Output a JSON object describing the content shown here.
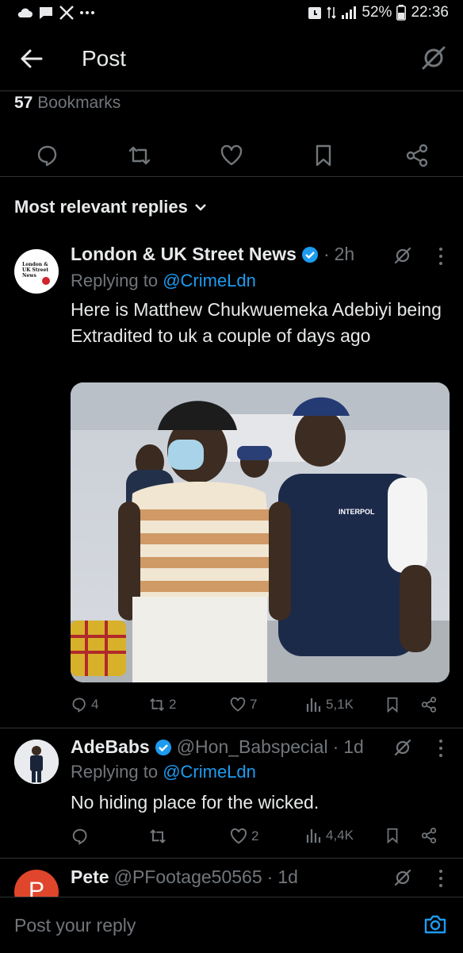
{
  "status_bar": {
    "battery": "52%",
    "time": "22:36",
    "left_icons": [
      "cloud-icon",
      "message-icon",
      "x-logo-icon",
      "more-dots-icon"
    ],
    "right_icons": [
      "alarm-icon",
      "data-arrows-icon",
      "signal-icon",
      "battery-icon"
    ]
  },
  "header": {
    "title": "Post"
  },
  "post": {
    "bookmarks_count": "57",
    "bookmarks_label": "Bookmarks"
  },
  "replies_filter": {
    "label": "Most relevant replies"
  },
  "replies": [
    {
      "name": "London & UK Street News",
      "verified": true,
      "time": "2h",
      "replying_prefix": "Replying to ",
      "replying_to": "@CrimeLdn",
      "text": "Here is Matthew Chukwuemeka Adebiyi being Extradited to uk a couple of days ago",
      "avatar_text": "London & UK Street News",
      "image_label": "INTERPOL",
      "stats": {
        "replies": "4",
        "reposts": "2",
        "likes": "7",
        "views": "5,1K"
      }
    },
    {
      "name": "AdeBabs",
      "verified": true,
      "handle": "@Hon_Babspecial",
      "time": "1d",
      "replying_prefix": "Replying to ",
      "replying_to": "@CrimeLdn",
      "text": "No hiding place for the wicked.",
      "stats": {
        "replies": "",
        "reposts": "",
        "likes": "2",
        "views": "4,4K"
      }
    },
    {
      "name": "Pete",
      "handle": "@PFootage50565",
      "time": "1d",
      "avatar_letter": "P"
    }
  ],
  "composer": {
    "placeholder": "Post your reply"
  },
  "colors": {
    "accent": "#1d9bf0",
    "background": "#000000",
    "muted": "#71767b",
    "text": "#e7e9ea"
  }
}
